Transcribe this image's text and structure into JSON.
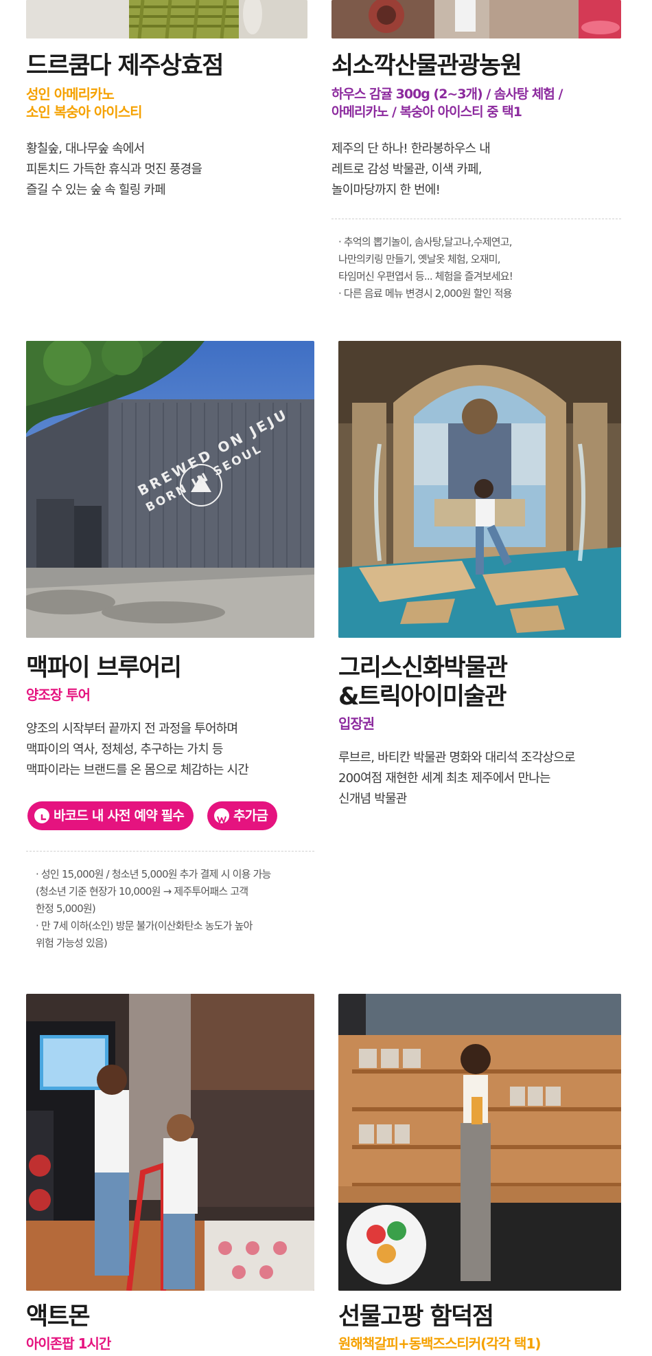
{
  "cards": [
    {
      "title_lines": [
        "드르쿰다 제주상효점"
      ],
      "subtitle_lines": [
        "성인 아메리카노",
        "소인 복숭아 아이스티"
      ],
      "desc_lines": [
        "황칠숲, 대나무숲 속에서",
        "피톤치드 가득한 휴식과 멋진 풍경을",
        "즐길 수 있는 숲 속 힐링 카페"
      ]
    },
    {
      "title_lines": [
        "쇠소깍산물관광농원"
      ],
      "subtitle_lines": [
        "하우스 감귤 300g (2~3개) / 솜사탕 체험 /",
        "아메리카노 / 복숭아 아이스티 중 택1"
      ],
      "desc_lines": [
        "제주의 단 하나! 한라봉하우스 내",
        "레트로 감성 박물관, 이색 카페,",
        "놀이마당까지 한 번에!"
      ],
      "notes": [
        "· 추억의 뽑기놀이, 솜사탕,달고나,수제연고,",
        "  나만의키링 만들기, 옛날옷 체험, 오재미,",
        "  타임머신 우편엽서 등...  체험을 즐겨보세요!",
        "· 다른 음료 메뉴 변경시 2,000원 할인 적용"
      ]
    },
    {
      "title_lines": [
        "맥파이 브루어리"
      ],
      "subtitle_lines": [
        "양조장 투어"
      ],
      "desc_lines": [
        "양조의 시작부터 끝까지 전 과정을 투어하며",
        "맥파이의 역사, 정체성, 추구하는 가치 등",
        "맥파이라는 브랜드를 온 몸으로 체감하는 시간"
      ],
      "badges": {
        "reservation": "바코드 내 사전 예약 필수",
        "extra_fee": "추가금"
      },
      "notes": [
        "· 성인 15,000원 / 청소년 5,000원 추가 결제 시 이용 가능",
        "  (청소년 기준 현장가 10,000원 → 제주투어패스 고객",
        "  한정 5,000원)",
        "· 만 7세 이하(소인) 방문 불가(이산화탄소 농도가 높아",
        "  위험 가능성 있음)"
      ],
      "photo_text": {
        "line1": "BREWED ON JEJU",
        "line2": "BORN IN SEOUL"
      }
    },
    {
      "title_lines": [
        "그리스신화박물관",
        "&트릭아이미술관"
      ],
      "subtitle_lines": [
        "입장권"
      ],
      "desc_lines": [
        "루브르, 바티칸 박물관 명화와 대리석 조각상으로",
        "200여점 재현한 세계 최초 제주에서 만나는",
        "신개념 박물관"
      ]
    },
    {
      "title_lines": [
        "액트몬"
      ],
      "subtitle_lines": [
        "아이존팝 1시간"
      ]
    },
    {
      "title_lines": [
        "선물고팡 함덕점"
      ],
      "subtitle_lines": [
        "원해책갈피+동백즈스티커(각각 택1)"
      ]
    }
  ],
  "colors": {
    "orange": "#f5a100",
    "pink": "#e5137f",
    "purple": "#8c2a9e"
  }
}
